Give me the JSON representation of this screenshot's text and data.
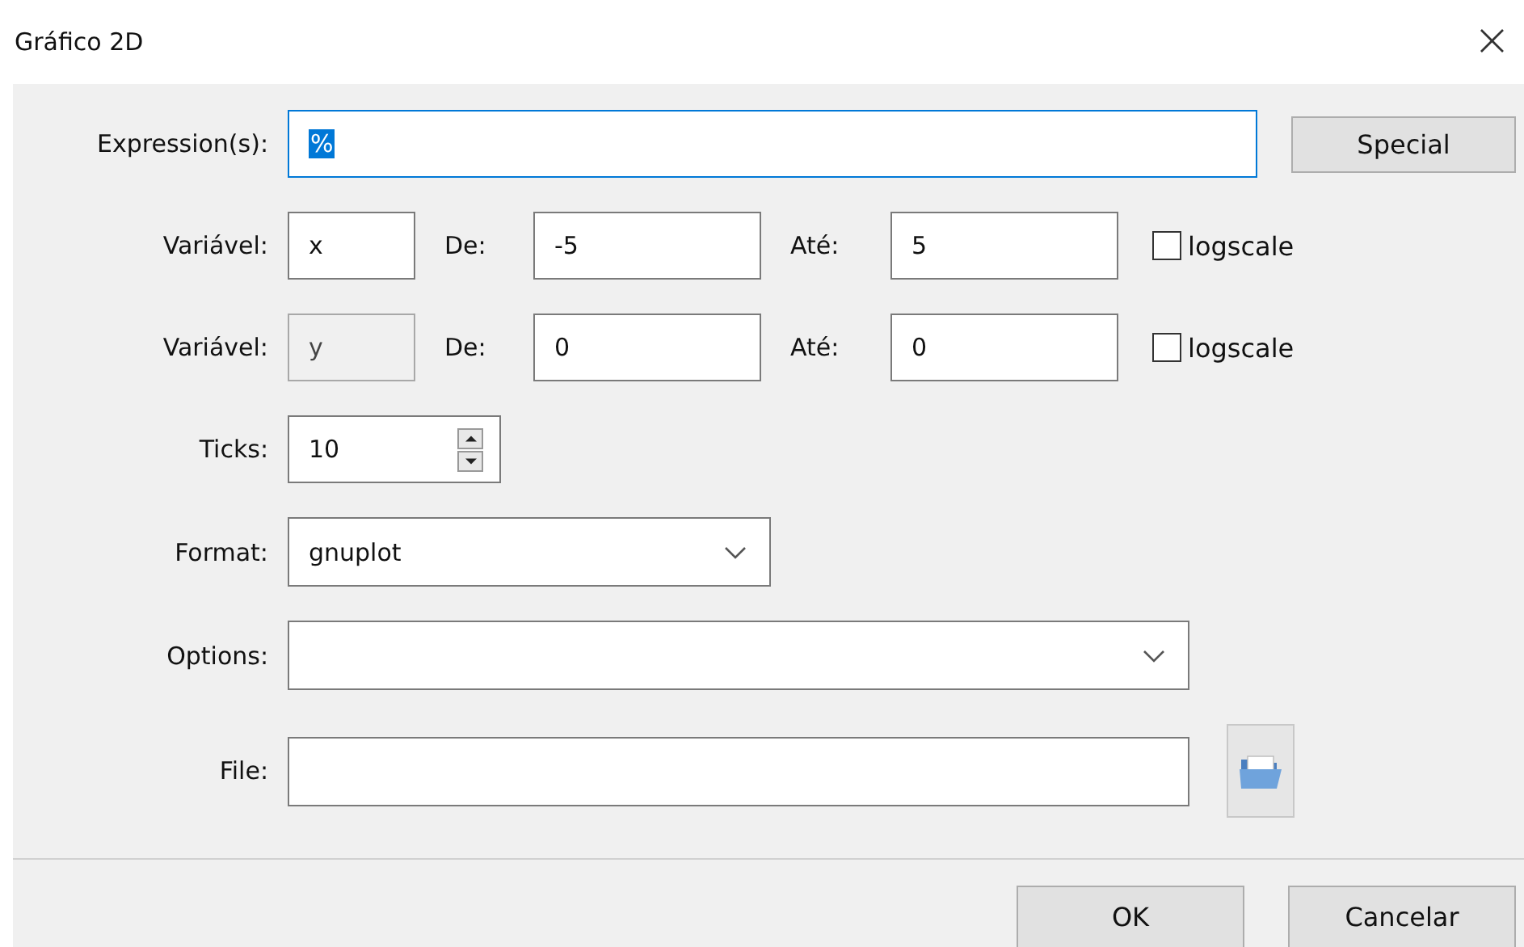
{
  "window": {
    "title": "Gráfico 2D",
    "close": "×"
  },
  "expression": {
    "label": "Expression(s):",
    "value": "%",
    "value_selected": true
  },
  "special_button": "Special",
  "variables": [
    {
      "label": "Variável:",
      "name": "x",
      "disabled": false,
      "from_label": "De:",
      "from": "-5",
      "to_label": "Até:",
      "to": "5",
      "logscale_label": "logscale",
      "logscale_checked": false
    },
    {
      "label": "Variável:",
      "name": "y",
      "disabled": true,
      "from_label": "De:",
      "from": "0",
      "to_label": "Até:",
      "to": "0",
      "logscale_label": "logscale",
      "logscale_checked": false
    }
  ],
  "ticks": {
    "label": "Ticks:",
    "value": "10"
  },
  "format": {
    "label": "Format:",
    "value": "gnuplot"
  },
  "options": {
    "label": "Options:"
  },
  "file": {
    "label": "File:"
  },
  "buttons": [
    "OK",
    "Cancelar"
  ]
}
